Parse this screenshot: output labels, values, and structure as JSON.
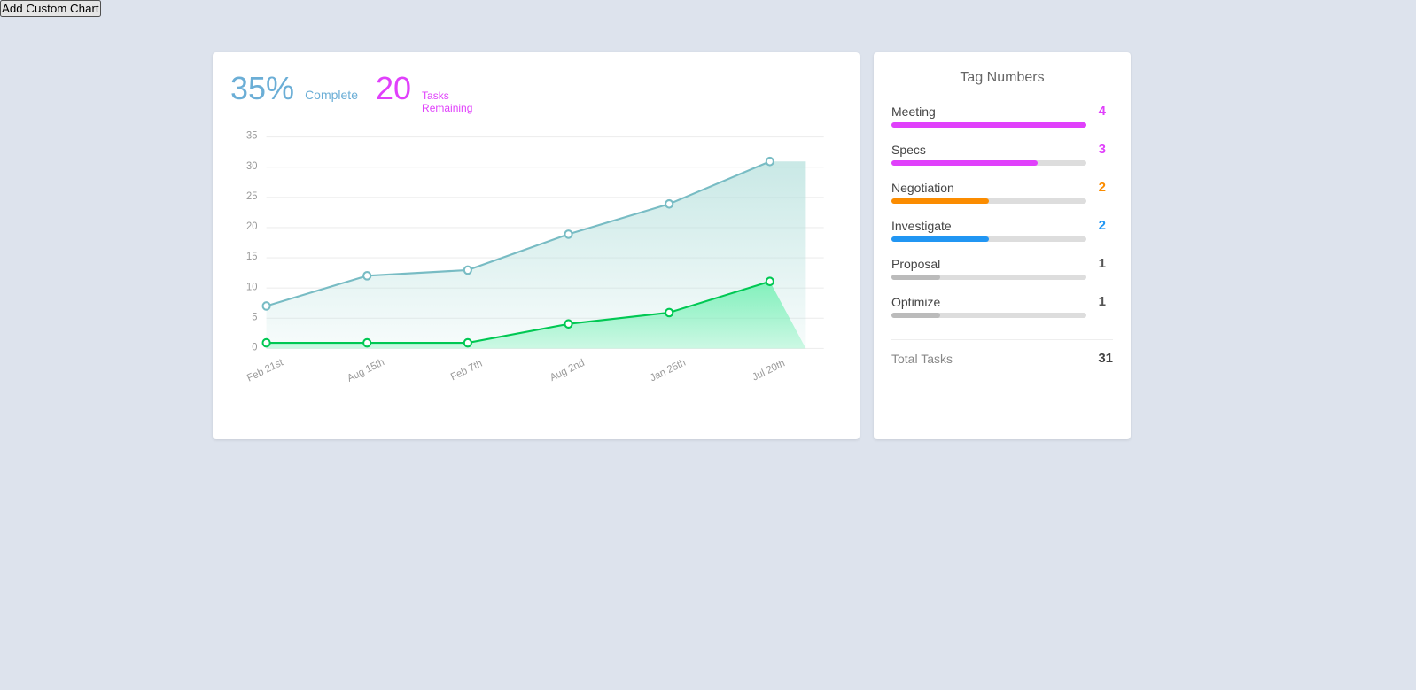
{
  "header": {
    "add_custom_chart": "Add Custom Chart"
  },
  "chart": {
    "percent": "35%",
    "complete_label": "Complete",
    "tasks_count": "20",
    "tasks_label_line1": "Tasks",
    "tasks_label_line2": "Remaining",
    "y_axis": [
      "35",
      "30",
      "25",
      "20",
      "15",
      "10",
      "5",
      "0"
    ],
    "x_axis": [
      "Feb 21st",
      "Aug 15th",
      "Feb 7th",
      "Aug 2nd",
      "Jan 25th",
      "Jul 20th"
    ],
    "area_color": "#b2dfdb",
    "line_color": "#78bcc4",
    "green_area_color": "#69f0ae",
    "green_line_color": "#00c853"
  },
  "tag_numbers": {
    "title": "Tag Numbers",
    "items": [
      {
        "name": "Meeting",
        "count": 4,
        "count_color": "#e040fb",
        "bar_color": "#e040fb",
        "bar_pct": 100
      },
      {
        "name": "Specs",
        "count": 3,
        "count_color": "#e040fb",
        "bar_color": "#e040fb",
        "bar_pct": 75
      },
      {
        "name": "Negotiation",
        "count": 2,
        "count_color": "#fb8c00",
        "bar_color": "#fb8c00",
        "bar_pct": 50
      },
      {
        "name": "Investigate",
        "count": 2,
        "count_color": "#2196f3",
        "bar_color": "#2196f3",
        "bar_pct": 50
      },
      {
        "name": "Proposal",
        "count": 1,
        "count_color": "#555",
        "bar_color": "#bbb",
        "bar_pct": 25
      },
      {
        "name": "Optimize",
        "count": 1,
        "count_color": "#555",
        "bar_color": "#bbb",
        "bar_pct": 25
      }
    ],
    "total_label": "Total Tasks",
    "total_count": 31
  }
}
